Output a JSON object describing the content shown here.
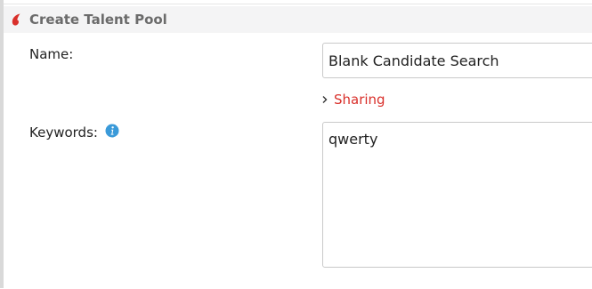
{
  "dialog": {
    "title": "Create Talent Pool",
    "icon": "bullhorn-logo-icon"
  },
  "form": {
    "name_label": "Name:",
    "name_value": "Blank Candidate Search",
    "sharing_label": "Sharing",
    "keywords_label": "Keywords:",
    "keywords_value": "qwerty"
  },
  "colors": {
    "accent_red": "#d9302b",
    "info_blue": "#3a9ad9"
  }
}
